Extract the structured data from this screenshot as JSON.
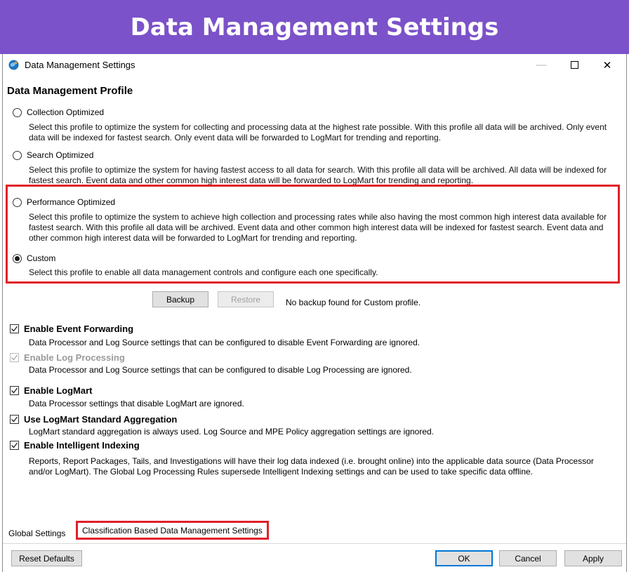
{
  "banner": {
    "title": "Data Management Settings"
  },
  "window": {
    "title": "Data Management Settings",
    "controls": {
      "minimize": "—",
      "close": "✕"
    },
    "icon": "app-globe-icon"
  },
  "profile": {
    "section_title": "Data Management Profile",
    "options": [
      {
        "label": "Collection Optimized",
        "checked": false,
        "desc": "Select this profile to optimize the system for collecting and processing data at the highest rate possible.  With this profile all data will be archived.  Only event data will be indexed for fastest search.  Only event data will be forwarded to LogMart for trending and reporting."
      },
      {
        "label": "Search Optimized",
        "checked": false,
        "desc": "Select this profile to optimize the system for having fastest access to all data for search.  With this profile all data will be archived.  All data will be indexed for fastest search.  Event data and other common high interest data will be forwarded to LogMart for trending and reporting."
      },
      {
        "label": "Performance Optimized",
        "checked": false,
        "desc": "Select this profile to optimize the system to achieve high collection and processing rates while also having the most common high interest data available for fastest search.  With this profile all data will be archived.  Event data and other common high interest data will be indexed for fastest search.  Event data and other common high interest data will be forwarded to LogMart for trending and reporting."
      },
      {
        "label": "Custom",
        "checked": true,
        "desc": "Select this profile to enable all data management controls and configure each one specifically."
      }
    ],
    "backup_label": "Backup",
    "restore_label": "Restore",
    "backup_message": "No backup found for Custom profile."
  },
  "settings": [
    {
      "label": "Enable Event Forwarding",
      "checked": true,
      "enabled": true,
      "desc": "Data Processor and Log Source settings that can be configured to disable Event Forwarding are ignored."
    },
    {
      "label": "Enable Log Processing",
      "checked": true,
      "enabled": false,
      "desc": "Data Processor and Log Source settings that can be configured to disable Log Processing are ignored."
    },
    {
      "label": "Enable LogMart",
      "checked": true,
      "enabled": true,
      "desc": "Data Processor settings that disable LogMart are ignored."
    },
    {
      "label": "Use LogMart Standard Aggregation",
      "checked": true,
      "enabled": true,
      "desc": "LogMart standard aggregation is always used.  Log Source and MPE Policy aggregation settings are ignored."
    },
    {
      "label": "Enable Intelligent Indexing",
      "checked": true,
      "enabled": true,
      "desc": "Reports, Report Packages, Tails, and Investigations will have their log data indexed (i.e. brought online) into the applicable data source (Data Processor and/or LogMart). The Global Log Processing Rules supersede Intelligent Indexing settings and can be used to take specific data offline."
    }
  ],
  "tabs": {
    "global": "Global Settings",
    "classification": "Classification Based Data Management Settings"
  },
  "footer": {
    "reset": "Reset Defaults",
    "ok": "OK",
    "cancel": "Cancel",
    "apply": "Apply"
  },
  "colors": {
    "banner": "#7b52c9",
    "highlight": "#e0202a",
    "default_button_border": "#0078d7"
  }
}
